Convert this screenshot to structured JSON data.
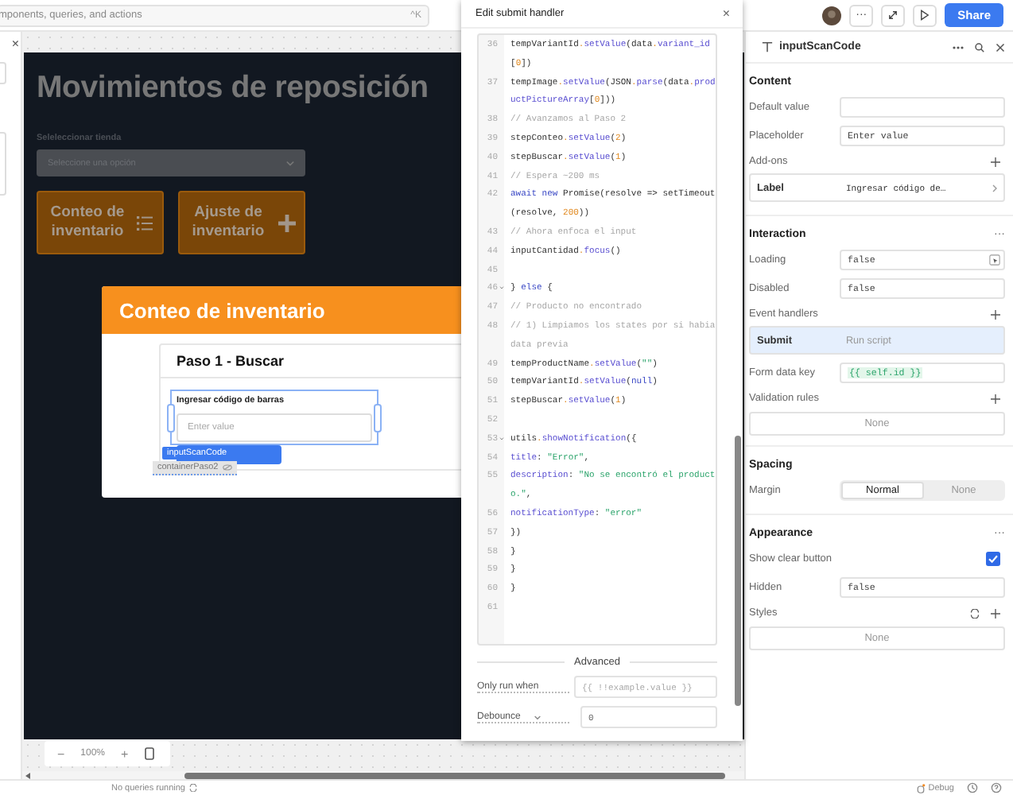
{
  "search": {
    "placeholder": "mponents, queries, and actions",
    "shortcut": "^K"
  },
  "toolbar": {
    "more": "···",
    "share": "Share"
  },
  "left_panel": {
    "close": "×"
  },
  "app": {
    "title": "Movimientos de reposición",
    "store_label": "Seleleccionar tienda",
    "store_select": {
      "placeholder": "Seleccione una opción"
    },
    "buttons": [
      {
        "label": "Conteo de inventario",
        "kind": "list"
      },
      {
        "label": "Ajuste de inventario",
        "kind": "plus"
      }
    ],
    "modal": {
      "title": "Conteo de inventario",
      "step_title": "Paso 1 - Buscar",
      "input": {
        "label": "Ingresar código de barras",
        "placeholder": "Enter value",
        "selected": true
      },
      "component_tag": "inputScanCode",
      "container_tag": "containerPaso2"
    }
  },
  "zoom": {
    "minus": "−",
    "level": "100%",
    "plus": "+"
  },
  "status": {
    "queries": "No queries running",
    "debug": "Debug"
  },
  "editor": {
    "title": "Edit submit handler",
    "close": "×",
    "lines": [
      {
        "number": "36",
        "fold": false,
        "segments": [
          {
            "kind": "plain",
            "text": "tempVariantId"
          },
          {
            "kind": "dot",
            "text": "."
          },
          {
            "kind": "member",
            "text": "setValue"
          },
          {
            "kind": "plain",
            "text": "(data"
          },
          {
            "kind": "dot",
            "text": "."
          },
          {
            "kind": "member",
            "text": "variant_id"
          },
          {
            "kind": "plain",
            "text": "["
          },
          {
            "kind": "number",
            "text": "0"
          },
          {
            "kind": "plain",
            "text": "])"
          }
        ]
      },
      {
        "number": "37",
        "fold": false,
        "segments": [
          {
            "kind": "plain",
            "text": "tempImage"
          },
          {
            "kind": "dot",
            "text": "."
          },
          {
            "kind": "member",
            "text": "setValue"
          },
          {
            "kind": "plain",
            "text": "(JSON"
          },
          {
            "kind": "dot",
            "text": "."
          },
          {
            "kind": "member",
            "text": "parse"
          },
          {
            "kind": "plain",
            "text": "(data"
          },
          {
            "kind": "dot",
            "text": "."
          },
          {
            "kind": "member",
            "text": "productPictureArray"
          },
          {
            "kind": "plain",
            "text": "["
          },
          {
            "kind": "number",
            "text": "0"
          },
          {
            "kind": "plain",
            "text": "]))"
          }
        ]
      },
      {
        "number": "38",
        "fold": false,
        "segments": [
          {
            "kind": "comment",
            "text": "// Avanzamos al Paso 2"
          }
        ]
      },
      {
        "number": "39",
        "fold": false,
        "segments": [
          {
            "kind": "plain",
            "text": "stepConteo"
          },
          {
            "kind": "dot",
            "text": "."
          },
          {
            "kind": "member",
            "text": "setValue"
          },
          {
            "kind": "plain",
            "text": "("
          },
          {
            "kind": "number",
            "text": "2"
          },
          {
            "kind": "plain",
            "text": ")"
          }
        ]
      },
      {
        "number": "40",
        "fold": false,
        "segments": [
          {
            "kind": "plain",
            "text": "stepBuscar"
          },
          {
            "kind": "dot",
            "text": "."
          },
          {
            "kind": "member",
            "text": "setValue"
          },
          {
            "kind": "plain",
            "text": "("
          },
          {
            "kind": "number",
            "text": "1"
          },
          {
            "kind": "plain",
            "text": ")"
          }
        ]
      },
      {
        "number": "41",
        "fold": false,
        "segments": [
          {
            "kind": "comment",
            "text": "// Espera ~200 ms"
          }
        ]
      },
      {
        "number": "42",
        "fold": false,
        "segments": [
          {
            "kind": "keyword",
            "text": "await new"
          },
          {
            "kind": "plain",
            "text": " Promise(resolve => setTimeout(resolve, "
          },
          {
            "kind": "number",
            "text": "200"
          },
          {
            "kind": "plain",
            "text": "))"
          }
        ]
      },
      {
        "number": "43",
        "fold": false,
        "segments": [
          {
            "kind": "comment",
            "text": "// Ahora enfoca el input"
          }
        ]
      },
      {
        "number": "44",
        "fold": false,
        "segments": [
          {
            "kind": "plain",
            "text": "inputCantidad"
          },
          {
            "kind": "dot",
            "text": "."
          },
          {
            "kind": "member",
            "text": "focus"
          },
          {
            "kind": "plain",
            "text": "()"
          }
        ]
      },
      {
        "number": "45",
        "fold": false
      },
      {
        "number": "46",
        "fold": true,
        "segments": [
          {
            "kind": "plain",
            "text": "} "
          },
          {
            "kind": "keyword",
            "text": "else"
          },
          {
            "kind": "plain",
            "text": " {"
          }
        ]
      },
      {
        "number": "47",
        "fold": false,
        "segments": [
          {
            "kind": "comment",
            "text": "// Producto no encontrado"
          }
        ]
      },
      {
        "number": "48",
        "fold": false,
        "segments": [
          {
            "kind": "comment",
            "text": "// 1) Limpiamos los states por si habia data previa"
          }
        ]
      },
      {
        "number": "49",
        "fold": false,
        "segments": [
          {
            "kind": "plain",
            "text": "tempProductName"
          },
          {
            "kind": "dot",
            "text": "."
          },
          {
            "kind": "member",
            "text": "setValue"
          },
          {
            "kind": "plain",
            "text": "("
          },
          {
            "kind": "string",
            "text": "\"\""
          },
          {
            "kind": "plain",
            "text": ")"
          }
        ]
      },
      {
        "number": "50",
        "fold": false,
        "segments": [
          {
            "kind": "plain",
            "text": "tempVariantId"
          },
          {
            "kind": "dot",
            "text": "."
          },
          {
            "kind": "member",
            "text": "setValue"
          },
          {
            "kind": "plain",
            "text": "("
          },
          {
            "kind": "keyword",
            "text": "null"
          },
          {
            "kind": "plain",
            "text": ")"
          }
        ]
      },
      {
        "number": "51",
        "fold": false,
        "segments": [
          {
            "kind": "plain",
            "text": "stepBuscar"
          },
          {
            "kind": "dot",
            "text": "."
          },
          {
            "kind": "member",
            "text": "setValue"
          },
          {
            "kind": "plain",
            "text": "("
          },
          {
            "kind": "number",
            "text": "1"
          },
          {
            "kind": "plain",
            "text": ")"
          }
        ]
      },
      {
        "number": "52",
        "fold": false
      },
      {
        "number": "53",
        "fold": true,
        "segments": [
          {
            "kind": "plain",
            "text": "utils"
          },
          {
            "kind": "dot",
            "text": "."
          },
          {
            "kind": "member",
            "text": "showNotification"
          },
          {
            "kind": "plain",
            "text": "({"
          }
        ]
      },
      {
        "number": "54",
        "fold": false,
        "segments": [
          {
            "kind": "member",
            "text": "title"
          },
          {
            "kind": "plain",
            "text": ": "
          },
          {
            "kind": "string",
            "text": "\"Error\""
          },
          {
            "kind": "plain",
            "text": ","
          }
        ]
      },
      {
        "number": "55",
        "fold": false,
        "segments": [
          {
            "kind": "member",
            "text": "description"
          },
          {
            "kind": "plain",
            "text": ": "
          },
          {
            "kind": "string",
            "text": "\"No se encontró el producto.\""
          },
          {
            "kind": "plain",
            "text": ","
          }
        ]
      },
      {
        "number": "56",
        "fold": false,
        "segments": [
          {
            "kind": "member",
            "text": "notificationType"
          },
          {
            "kind": "plain",
            "text": ": "
          },
          {
            "kind": "string",
            "text": "\"error\""
          }
        ]
      },
      {
        "number": "57",
        "fold": false,
        "segments": [
          {
            "kind": "plain",
            "text": "})"
          }
        ]
      },
      {
        "number": "58",
        "fold": false,
        "segments": [
          {
            "kind": "plain",
            "text": "}"
          }
        ]
      },
      {
        "number": "59",
        "fold": false,
        "segments": [
          {
            "kind": "plain",
            "text": "}"
          }
        ]
      },
      {
        "number": "60",
        "fold": false,
        "segments": [
          {
            "kind": "plain",
            "text": "}"
          }
        ]
      },
      {
        "number": "61",
        "fold": false
      }
    ],
    "advanced": "Advanced",
    "only_run_when": {
      "label": "Only run when",
      "placeholder": "{{ !!example.value }}"
    },
    "debounce": {
      "label": "Debounce",
      "value": "0"
    }
  },
  "inspector": {
    "title": "inputScanCode",
    "sections": [
      {
        "title": "Content",
        "rows": [
          {
            "kind": "field",
            "label": "Default value"
          },
          {
            "kind": "field",
            "label": "Placeholder",
            "value": "Enter value"
          },
          {
            "kind": "heading",
            "label": "Add-ons"
          },
          {
            "kind": "item",
            "label": "Label",
            "value": "Ingresar código de…"
          }
        ]
      },
      {
        "title": "Interaction",
        "menu": "···",
        "rows": [
          {
            "kind": "field_action",
            "label": "Loading",
            "value": "false"
          },
          {
            "kind": "field",
            "label": "Disabled",
            "value": "false"
          },
          {
            "kind": "heading",
            "label": "Event handlers"
          },
          {
            "kind": "handler",
            "label": "Submit",
            "value": "Run script",
            "selected": true
          },
          {
            "kind": "code_field",
            "label": "Form data key",
            "value": "{{ self.id }}"
          },
          {
            "kind": "heading",
            "label": "Validation rules"
          },
          {
            "kind": "none",
            "label": "None"
          }
        ]
      },
      {
        "title": "Spacing",
        "rows": [
          {
            "kind": "segmented",
            "label": "Margin",
            "options": [
              {
                "label": "Normal",
                "selected": true
              },
              {
                "label": "None",
                "selected": false
              }
            ]
          }
        ]
      },
      {
        "title": "Appearance",
        "menu": "···",
        "rows": [
          {
            "kind": "checkbox",
            "label": "Show clear button",
            "checked": true
          },
          {
            "kind": "field",
            "label": "Hidden",
            "value": "false"
          },
          {
            "kind": "styles",
            "label": "Styles"
          },
          {
            "kind": "none",
            "label": "None"
          }
        ]
      }
    ]
  }
}
